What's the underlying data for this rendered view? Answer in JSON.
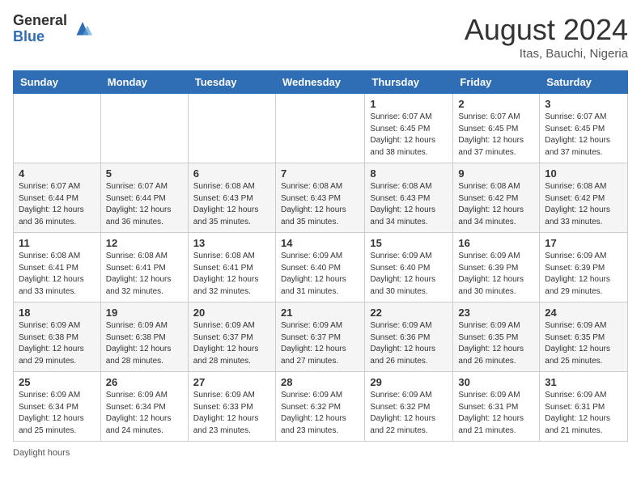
{
  "header": {
    "logo_general": "General",
    "logo_blue": "Blue",
    "month_year": "August 2024",
    "location": "Itas, Bauchi, Nigeria"
  },
  "days_of_week": [
    "Sunday",
    "Monday",
    "Tuesday",
    "Wednesday",
    "Thursday",
    "Friday",
    "Saturday"
  ],
  "footer": {
    "note": "Daylight hours"
  },
  "weeks": [
    [
      {
        "day": "",
        "info": ""
      },
      {
        "day": "",
        "info": ""
      },
      {
        "day": "",
        "info": ""
      },
      {
        "day": "",
        "info": ""
      },
      {
        "day": "1",
        "info": "Sunrise: 6:07 AM\nSunset: 6:45 PM\nDaylight: 12 hours\nand 38 minutes."
      },
      {
        "day": "2",
        "info": "Sunrise: 6:07 AM\nSunset: 6:45 PM\nDaylight: 12 hours\nand 37 minutes."
      },
      {
        "day": "3",
        "info": "Sunrise: 6:07 AM\nSunset: 6:45 PM\nDaylight: 12 hours\nand 37 minutes."
      }
    ],
    [
      {
        "day": "4",
        "info": "Sunrise: 6:07 AM\nSunset: 6:44 PM\nDaylight: 12 hours\nand 36 minutes."
      },
      {
        "day": "5",
        "info": "Sunrise: 6:07 AM\nSunset: 6:44 PM\nDaylight: 12 hours\nand 36 minutes."
      },
      {
        "day": "6",
        "info": "Sunrise: 6:08 AM\nSunset: 6:43 PM\nDaylight: 12 hours\nand 35 minutes."
      },
      {
        "day": "7",
        "info": "Sunrise: 6:08 AM\nSunset: 6:43 PM\nDaylight: 12 hours\nand 35 minutes."
      },
      {
        "day": "8",
        "info": "Sunrise: 6:08 AM\nSunset: 6:43 PM\nDaylight: 12 hours\nand 34 minutes."
      },
      {
        "day": "9",
        "info": "Sunrise: 6:08 AM\nSunset: 6:42 PM\nDaylight: 12 hours\nand 34 minutes."
      },
      {
        "day": "10",
        "info": "Sunrise: 6:08 AM\nSunset: 6:42 PM\nDaylight: 12 hours\nand 33 minutes."
      }
    ],
    [
      {
        "day": "11",
        "info": "Sunrise: 6:08 AM\nSunset: 6:41 PM\nDaylight: 12 hours\nand 33 minutes."
      },
      {
        "day": "12",
        "info": "Sunrise: 6:08 AM\nSunset: 6:41 PM\nDaylight: 12 hours\nand 32 minutes."
      },
      {
        "day": "13",
        "info": "Sunrise: 6:08 AM\nSunset: 6:41 PM\nDaylight: 12 hours\nand 32 minutes."
      },
      {
        "day": "14",
        "info": "Sunrise: 6:09 AM\nSunset: 6:40 PM\nDaylight: 12 hours\nand 31 minutes."
      },
      {
        "day": "15",
        "info": "Sunrise: 6:09 AM\nSunset: 6:40 PM\nDaylight: 12 hours\nand 30 minutes."
      },
      {
        "day": "16",
        "info": "Sunrise: 6:09 AM\nSunset: 6:39 PM\nDaylight: 12 hours\nand 30 minutes."
      },
      {
        "day": "17",
        "info": "Sunrise: 6:09 AM\nSunset: 6:39 PM\nDaylight: 12 hours\nand 29 minutes."
      }
    ],
    [
      {
        "day": "18",
        "info": "Sunrise: 6:09 AM\nSunset: 6:38 PM\nDaylight: 12 hours\nand 29 minutes."
      },
      {
        "day": "19",
        "info": "Sunrise: 6:09 AM\nSunset: 6:38 PM\nDaylight: 12 hours\nand 28 minutes."
      },
      {
        "day": "20",
        "info": "Sunrise: 6:09 AM\nSunset: 6:37 PM\nDaylight: 12 hours\nand 28 minutes."
      },
      {
        "day": "21",
        "info": "Sunrise: 6:09 AM\nSunset: 6:37 PM\nDaylight: 12 hours\nand 27 minutes."
      },
      {
        "day": "22",
        "info": "Sunrise: 6:09 AM\nSunset: 6:36 PM\nDaylight: 12 hours\nand 26 minutes."
      },
      {
        "day": "23",
        "info": "Sunrise: 6:09 AM\nSunset: 6:35 PM\nDaylight: 12 hours\nand 26 minutes."
      },
      {
        "day": "24",
        "info": "Sunrise: 6:09 AM\nSunset: 6:35 PM\nDaylight: 12 hours\nand 25 minutes."
      }
    ],
    [
      {
        "day": "25",
        "info": "Sunrise: 6:09 AM\nSunset: 6:34 PM\nDaylight: 12 hours\nand 25 minutes."
      },
      {
        "day": "26",
        "info": "Sunrise: 6:09 AM\nSunset: 6:34 PM\nDaylight: 12 hours\nand 24 minutes."
      },
      {
        "day": "27",
        "info": "Sunrise: 6:09 AM\nSunset: 6:33 PM\nDaylight: 12 hours\nand 23 minutes."
      },
      {
        "day": "28",
        "info": "Sunrise: 6:09 AM\nSunset: 6:32 PM\nDaylight: 12 hours\nand 23 minutes."
      },
      {
        "day": "29",
        "info": "Sunrise: 6:09 AM\nSunset: 6:32 PM\nDaylight: 12 hours\nand 22 minutes."
      },
      {
        "day": "30",
        "info": "Sunrise: 6:09 AM\nSunset: 6:31 PM\nDaylight: 12 hours\nand 21 minutes."
      },
      {
        "day": "31",
        "info": "Sunrise: 6:09 AM\nSunset: 6:31 PM\nDaylight: 12 hours\nand 21 minutes."
      }
    ]
  ]
}
